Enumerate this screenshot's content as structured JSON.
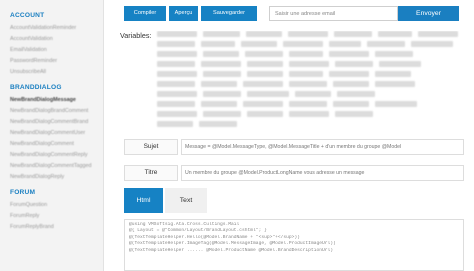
{
  "sidebar": {
    "sections": [
      {
        "title": "ACCOUNT",
        "items": [
          {
            "label": "AccountValidationReminder",
            "active": false
          },
          {
            "label": "AccountValidation",
            "active": false
          },
          {
            "label": "EmailValidation",
            "active": false
          },
          {
            "label": "PasswordReminder",
            "active": false
          },
          {
            "label": "UnsubscribeAll",
            "active": false
          }
        ]
      },
      {
        "title": "BRANDDIALOG",
        "items": [
          {
            "label": "NewBrandDialogMessage",
            "active": true
          },
          {
            "label": "NewBrandDialogBrandComment",
            "active": false
          },
          {
            "label": "NewBrandDialogCommentBrand",
            "active": false
          },
          {
            "label": "NewBrandDialogCommentUser",
            "active": false
          },
          {
            "label": "NewBrandDialogComment",
            "active": false
          },
          {
            "label": "NewBrandDialogCommentReply",
            "active": false
          },
          {
            "label": "NewBrandDialogCommentTagged",
            "active": false
          },
          {
            "label": "NewBrandDialogReply",
            "active": false
          }
        ]
      },
      {
        "title": "FORUM",
        "items": [
          {
            "label": "ForumQuestion",
            "active": false
          },
          {
            "label": "ForumReply",
            "active": false
          },
          {
            "label": "ForumReplyBrand",
            "active": false
          }
        ]
      }
    ]
  },
  "toolbar": {
    "compiler": "Compiler",
    "apercu": "Aperçu",
    "save": "Sauvegarder",
    "email_placeholder": "Saisir une adresse email",
    "send": "Envoyer"
  },
  "variables": {
    "label": "Variables:"
  },
  "fields": {
    "sujet_label": "Sujet",
    "sujet_value": "Message = @Model.MessageType, @Model.MessageTitle + d'un membre du groupe @Model",
    "titre_label": "Titre",
    "titre_value": "Un membre du groupe @Model.ProductLongName vous adresse un message"
  },
  "tabs": {
    "html": "Html",
    "text": "Text"
  },
  "editor": {
    "lines": [
      "@using VMSoftsig.Ata.Cross.Cultings.Mail",
      "@{ Layout = @\"Common/Layout/BrandLayout.cshtml\"; }",
      "",
      "@(TextTemplateHelper.Hello(@Model.BrandName + \"<sup>\"+</sup>))",
      "@(TextTemplateHelper.ImageTag(@Model.MessageImage, @Model.ProductImageUrl))",
      "@(TextTemplateHelper ...... @Model.ProductName @Model.BrandDescriptionUrl)"
    ]
  }
}
